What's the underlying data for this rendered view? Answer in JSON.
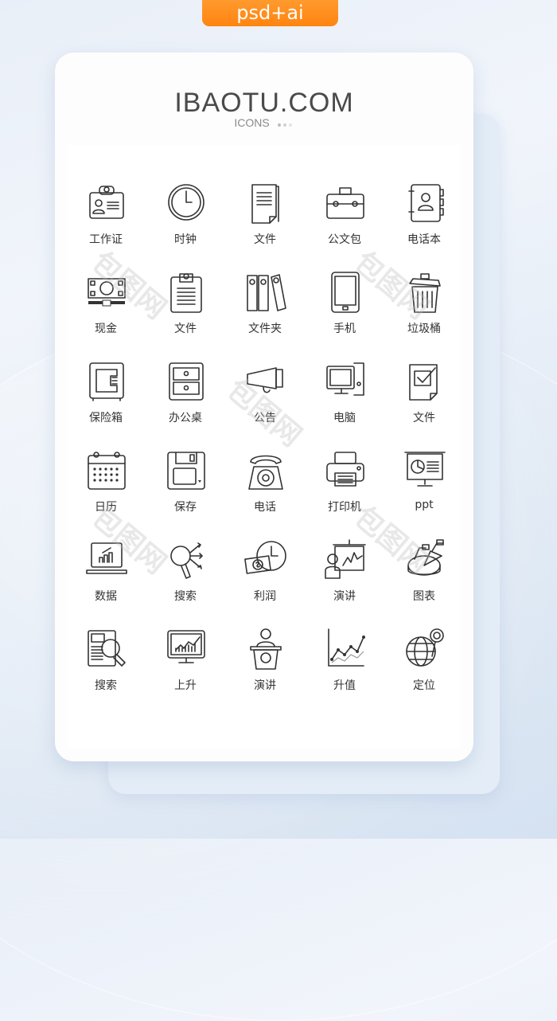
{
  "badge": {
    "label": "psd+ai",
    "color": "#ff8a18"
  },
  "header": {
    "title": "IBAOTU.COM",
    "subtitle": "ICONS",
    "dot_colors": [
      "#bdbdbd",
      "#d0d0d0",
      "#e3e3e3"
    ]
  },
  "watermark": {
    "text": "包图网"
  },
  "icons": [
    {
      "label": "工作证",
      "icon": "id-badge"
    },
    {
      "label": "时钟",
      "icon": "clock"
    },
    {
      "label": "文件",
      "icon": "document"
    },
    {
      "label": "公文包",
      "icon": "briefcase"
    },
    {
      "label": "电话本",
      "icon": "address-book"
    },
    {
      "label": "现金",
      "icon": "cash"
    },
    {
      "label": "文件",
      "icon": "clipboard"
    },
    {
      "label": "文件夹",
      "icon": "binders"
    },
    {
      "label": "手机",
      "icon": "tablet"
    },
    {
      "label": "垃圾桶",
      "icon": "trash-can"
    },
    {
      "label": "保险箱",
      "icon": "safe"
    },
    {
      "label": "办公桌",
      "icon": "drawer-cabinet"
    },
    {
      "label": "公告",
      "icon": "megaphone"
    },
    {
      "label": "电脑",
      "icon": "desktop-computer"
    },
    {
      "label": "文件",
      "icon": "checked-document"
    },
    {
      "label": "日历",
      "icon": "calendar"
    },
    {
      "label": "保存",
      "icon": "floppy-disk"
    },
    {
      "label": "电话",
      "icon": "rotary-phone"
    },
    {
      "label": "打印机",
      "icon": "printer"
    },
    {
      "label": "ppt",
      "icon": "presentation-board"
    },
    {
      "label": "数据",
      "icon": "laptop-chart"
    },
    {
      "label": "搜索",
      "icon": "magnifier-arrows"
    },
    {
      "label": "利润",
      "icon": "money-clock"
    },
    {
      "label": "演讲",
      "icon": "presenter-board"
    },
    {
      "label": "图表",
      "icon": "pie-chart"
    },
    {
      "label": "搜索",
      "icon": "search-document"
    },
    {
      "label": "上升",
      "icon": "monitor-growth"
    },
    {
      "label": "演讲",
      "icon": "podium-speaker"
    },
    {
      "label": "升值",
      "icon": "line-graph"
    },
    {
      "label": "定位",
      "icon": "globe-pin"
    }
  ]
}
